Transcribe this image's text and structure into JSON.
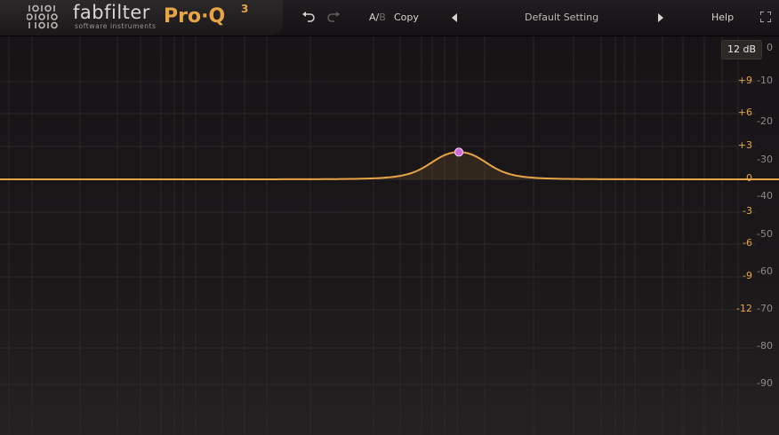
{
  "app": {
    "brand": "fabfilter",
    "brand_subtitle": "software instruments",
    "product": "Pro·Q",
    "product_version": "3",
    "accent_color": "#e8a545",
    "node_color": "#d06ad8"
  },
  "toolbar": {
    "undo_icon": "undo-icon",
    "redo_icon": "redo-icon",
    "ab_a": "A/",
    "ab_b": "B",
    "copy_label": "Copy",
    "prev_preset_icon": "triangle-left-icon",
    "preset_name": "Default Setting",
    "next_preset_icon": "triangle-right-icon",
    "help_label": "Help",
    "fullscreen_icon": "fullscreen-icon"
  },
  "display": {
    "range_label": "12 dB",
    "eq_scale": [
      "+9",
      "+6",
      "+3",
      "0",
      "-3",
      "-6",
      "-9",
      "-12"
    ],
    "spectrum_scale": [
      "0",
      "-10",
      "-20",
      "-30",
      "-40",
      "-50",
      "-60",
      "-70",
      "-80",
      "-90"
    ]
  },
  "band": {
    "gain_db": 2.0,
    "shape": "bell"
  }
}
